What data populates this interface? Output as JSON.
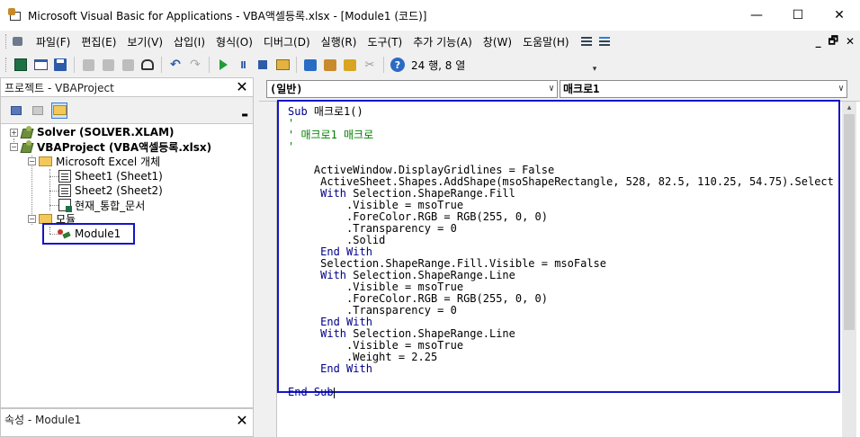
{
  "window": {
    "title": "Microsoft Visual Basic for Applications - VBA액셀등록.xlsx - [Module1 (코드)]",
    "minimize": "—",
    "maximize": "☐",
    "close": "✕"
  },
  "menu": {
    "items": [
      "파일(F)",
      "편집(E)",
      "보기(V)",
      "삽입(I)",
      "형식(O)",
      "디버그(D)",
      "실행(R)",
      "도구(T)",
      "추가 기능(A)",
      "창(W)",
      "도움말(H)"
    ],
    "mdi_min": "_",
    "mdi_restore": "🗗",
    "mdi_close": "✕"
  },
  "toolbar": {
    "icons": [
      "excel-icon",
      "insert-form-icon",
      "save-icon",
      "cut-icon",
      "copy-icon",
      "paste-icon",
      "find-icon",
      "undo-icon",
      "redo-icon",
      "run-icon",
      "break-icon",
      "reset-icon",
      "design-mode-icon",
      "project-explorer-icon",
      "properties-icon",
      "object-browser-icon",
      "toolbox-icon",
      "help-icon"
    ],
    "position": "24 행, 8 열"
  },
  "project_pane": {
    "title": "프로젝트 - VBAProject",
    "close": "✕",
    "tree": {
      "solver": "Solver (SOLVER.XLAM)",
      "vbaproject": "VBAProject (VBA액셀등록.xlsx)",
      "excel_objects": "Microsoft Excel 개체",
      "sheet1": "Sheet1 (Sheet1)",
      "sheet2": "Sheet2 (Sheet2)",
      "workbook": "현재_통합_문서",
      "modules": "모듈",
      "module1": "Module1"
    }
  },
  "props_pane": {
    "title": "속성 - Module1",
    "close": "✕"
  },
  "code": {
    "object_combo": "(일반)",
    "proc_combo": "매크로1",
    "lines": [
      {
        "text": "Sub 매크로1()",
        "kind": "sub"
      },
      {
        "text": "'",
        "kind": "comment"
      },
      {
        "text": "' 매크로1 매크로",
        "kind": "comment"
      },
      {
        "text": "'",
        "kind": "comment"
      },
      {
        "text": "",
        "kind": "plain"
      },
      {
        "text": "    ActiveWindow.DisplayGridlines = False",
        "kind": "plain"
      },
      {
        "text": "     ActiveSheet.Shapes.AddShape(msoShapeRectangle, 528, 82.5, 110.25, 54.75).Select",
        "kind": "plain"
      },
      {
        "text": "     With Selection.ShapeRange.Fill",
        "kind": "with"
      },
      {
        "text": "         .Visible = msoTrue",
        "kind": "plain"
      },
      {
        "text": "         .ForeColor.RGB = RGB(255, 0, 0)",
        "kind": "plain"
      },
      {
        "text": "         .Transparency = 0",
        "kind": "plain"
      },
      {
        "text": "         .Solid",
        "kind": "plain"
      },
      {
        "text": "     End With",
        "kind": "endwith"
      },
      {
        "text": "     Selection.ShapeRange.Fill.Visible = msoFalse",
        "kind": "plain"
      },
      {
        "text": "     With Selection.ShapeRange.Line",
        "kind": "with"
      },
      {
        "text": "         .Visible = msoTrue",
        "kind": "plain"
      },
      {
        "text": "         .ForeColor.RGB = RGB(255, 0, 0)",
        "kind": "plain"
      },
      {
        "text": "         .Transparency = 0",
        "kind": "plain"
      },
      {
        "text": "     End With",
        "kind": "endwith"
      },
      {
        "text": "     With Selection.ShapeRange.Line",
        "kind": "with"
      },
      {
        "text": "         .Visible = msoTrue",
        "kind": "plain"
      },
      {
        "text": "         .Weight = 2.25",
        "kind": "plain"
      },
      {
        "text": "     End With",
        "kind": "endwith"
      },
      {
        "text": "",
        "kind": "plain"
      },
      {
        "text": "End Sub",
        "kind": "endsub"
      }
    ]
  },
  "colors": {
    "highlight_border": "#1515c8",
    "keyword": "#00008b",
    "comment": "#008000"
  }
}
